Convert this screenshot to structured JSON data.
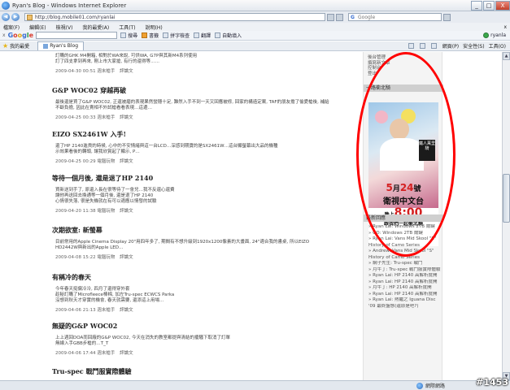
{
  "window": {
    "title": "Ryan's Blog - Windows Internet Explorer",
    "minimize": "_",
    "maximize": "□",
    "close": "X"
  },
  "address": {
    "url": "http://blog.mobile01.com/ryanlai",
    "search_placeholder": "Google"
  },
  "menu": {
    "items": [
      "檔案(F)",
      "編輯(E)",
      "檢視(V)",
      "我的最愛(A)",
      "工具(T)",
      "說明(H)"
    ],
    "close_x": "x"
  },
  "google_toolbar": {
    "x": "x",
    "logo": "Google",
    "search_label": "搜尋",
    "bookmarks_label": "書籤",
    "spell_label": "拼字檢查",
    "translate_label": "翻譯",
    "autofill_label": "自動填入",
    "account": "ryanla"
  },
  "favorites": {
    "label": "我的最愛",
    "tab_title": "Ryan's Blog",
    "page_label": "網頁(P)",
    "safety_label": "安全性(S)",
    "tools_label": "工具(O)"
  },
  "posts": [
    {
      "title": "",
      "body": "訂購的GHK M4開箱, 相對於WA來說, 可供WA, G7P與其新M4系列使用\n訂了四支拿到再來, 剛上市大家搶, 有行的還得等……",
      "date": "2009-04-30 00:51",
      "author": "週末槍手",
      "link": "評論文"
    },
    {
      "title": "G&P WOC02 穿越再破",
      "body": "最後還是買了G&P WOC02, 正還被磨的表現果然蠻穩十足, 難然入手不到一天又回應被修, 回家的構造定案, TAF的朋友擔了偷愛槍後, 補給\n不斷負擔, 因此在賣相不外試槍看看表現…這邊…",
      "date": "2009-04-25 00:33",
      "author": "週末槍手",
      "link": "評論文"
    },
    {
      "title": "EIZO SX2461W 入手!",
      "body": "還了HP 2140進貨的時候, 心中的不安情緒與這一台LCD…深感到期寶的是SX2461W…這台顯螢幕出大品的機種\n示效果看後的轉頭, 讓我欣賞起了顯示, P…",
      "date": "2009-04-25 00:29",
      "author": "電腦玩物",
      "link": "評論文"
    },
    {
      "title": "等待一個月後, 還是退了HP 2140",
      "body": "買新送到手了, 原還入長在很等待了一會兒…我不反還心還費\n讓他再送回去換通等一個月後, 還是退了HP 2140\n心情很失落, 很是失機就在有可以適應以情發的試驗",
      "date": "2009-04-20 11:38",
      "author": "電腦玩物",
      "link": "評論文"
    },
    {
      "title": "次期欲室: 新螢幕",
      "body": "目前常用的Apple Cinema Display 20\"用四年多了, 期間有不想升級到1920x1200像素的大畫面, 24\"適合我的書桌, 所以EIZO\nHD2442W與新出的Apple LED…",
      "date": "2009-04-08 15:22",
      "author": "電腦玩物",
      "link": "評論文"
    },
    {
      "title": "有稱冷的春天",
      "body": "今年春天挺偏冷冷, 四月了還得穿外套\n趁秘訂購了Microfleece棒棉, 加左Tru-spec ECWCS Parka\n沒想到秋天才穿實的機會, 春天就需要, 還添這上用場…",
      "date": "2009-04-06 21:13",
      "author": "週末槍手",
      "link": "評論文"
    },
    {
      "title": "無疑的G&P WOC02",
      "body": "上上週回DOA而回廠的G&P WOC02, 今天在消失的教室都提與清結的擾騷下取消了訂單\n無線入手GBB步槍的…T_T",
      "date": "2009-04-06 17:44",
      "author": "週末槍手",
      "link": "評論文"
    },
    {
      "title": "Tru-spec 戰鬥服實際體驗",
      "body": "",
      "date": "",
      "author": "",
      "link": ""
    }
  ],
  "sidebar": {
    "links": [
      "後台管理",
      "撰寫新文章",
      "控制台",
      "登出"
    ],
    "banner_header": "一路衝北騎",
    "banner": {
      "seal_text": "鐵人萬里騎",
      "date_num": "5",
      "date_month": "月",
      "date_day": "24",
      "date_suffix": "號",
      "venue": "衛視中文台",
      "time_prefix": "晚上",
      "time": "8:00",
      "tagline": "跟我們一起衝北騎"
    },
    "recent_header": "最新回應",
    "recent": [
      "» Ryan Lai: Windows 2TB 爾鍵",
      "» GD: Windows 2TB 爾鍵",
      "» Ryan Lai: Vans Mid Skool \"S\"",
      "  History of Camo Series",
      "» Andrew: Vans Mid Skool \"S\"",
      "  History of Camo Series",
      "» 網子先生: Tru-spec 戰鬥",
      "» 月牛丁: Tru-spec 戰鬥服實際體驗",
      "» Ryan Lai: HP 2140 高解析度開",
      "» Ryan Lai: HP 2140 高解析度開",
      "» 月牛丁: HP 2140 高解析度開",
      "» Ryan Lai: HP 2140 高解析度開",
      "» Ryan Lai: 熱繼之 Iguana Disc",
      "  '09 最終盤態(還原是吧?)"
    ]
  },
  "status": {
    "zone": "網際網路",
    "watermark": "#1453"
  },
  "colors": {
    "highlight": "#ff0000",
    "banner_red": "#d42020"
  }
}
